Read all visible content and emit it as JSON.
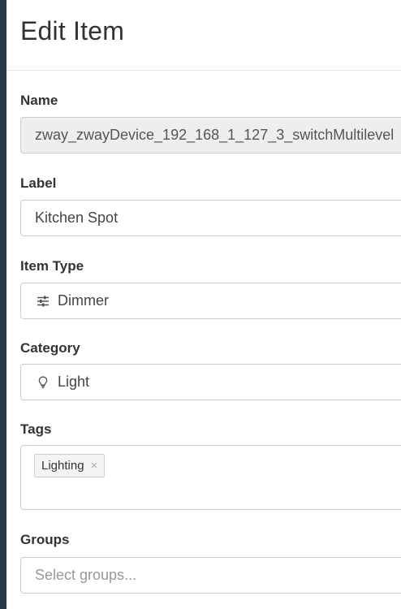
{
  "dialog": {
    "title": "Edit Item"
  },
  "fields": {
    "name": {
      "label": "Name",
      "value": "zway_zwayDevice_192_168_1_127_3_switchMultilevel"
    },
    "label": {
      "label": "Label",
      "value": "Kitchen Spot"
    },
    "item_type": {
      "label": "Item Type",
      "value": "Dimmer",
      "icon": "sliders-icon"
    },
    "category": {
      "label": "Category",
      "value": "Light",
      "icon": "lightbulb-icon"
    },
    "tags": {
      "label": "Tags",
      "items": [
        {
          "label": "Lighting",
          "remove_glyph": "×"
        }
      ]
    },
    "groups": {
      "label": "Groups",
      "placeholder": "Select groups..."
    }
  },
  "colors": {
    "backdrop": "#2b3a4a",
    "readonly_bg": "#eeeeee",
    "border": "#cccccc",
    "tag_bg": "#f4f4f4"
  }
}
